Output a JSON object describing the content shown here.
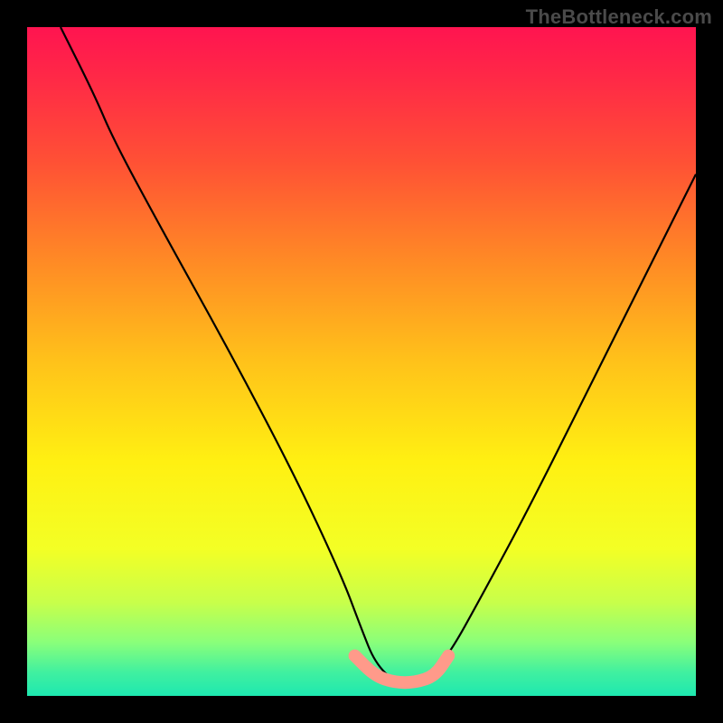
{
  "watermark": "TheBottleneck.com",
  "chart_data": {
    "type": "line",
    "title": "",
    "xlabel": "",
    "ylabel": "",
    "xlim": [
      0,
      100
    ],
    "ylim": [
      0,
      100
    ],
    "background_gradient": {
      "stops": [
        {
          "offset": 0.0,
          "color": "#ff1450"
        },
        {
          "offset": 0.08,
          "color": "#ff2a46"
        },
        {
          "offset": 0.2,
          "color": "#ff5035"
        },
        {
          "offset": 0.35,
          "color": "#ff8a25"
        },
        {
          "offset": 0.5,
          "color": "#ffc21a"
        },
        {
          "offset": 0.65,
          "color": "#fff012"
        },
        {
          "offset": 0.78,
          "color": "#f3ff25"
        },
        {
          "offset": 0.86,
          "color": "#c8ff4a"
        },
        {
          "offset": 0.92,
          "color": "#8aff7a"
        },
        {
          "offset": 0.965,
          "color": "#40f0a0"
        },
        {
          "offset": 1.0,
          "color": "#1ee8b0"
        }
      ]
    },
    "series": [
      {
        "name": "bottleneck-curve",
        "color": "#000000",
        "x": [
          5,
          10,
          13,
          20,
          30,
          40,
          47,
          50,
          52,
          55,
          58,
          60,
          63,
          68,
          75,
          85,
          95,
          100
        ],
        "y": [
          100,
          90,
          83,
          70,
          52,
          33,
          18,
          10,
          5,
          2,
          2,
          3,
          6,
          15,
          28,
          48,
          68,
          78
        ]
      }
    ],
    "highlight": {
      "name": "minimum-band",
      "color": "#ff9a8a",
      "x": [
        49,
        52,
        55,
        58,
        61,
        63
      ],
      "y": [
        6,
        3,
        2,
        2,
        3,
        6
      ]
    }
  }
}
